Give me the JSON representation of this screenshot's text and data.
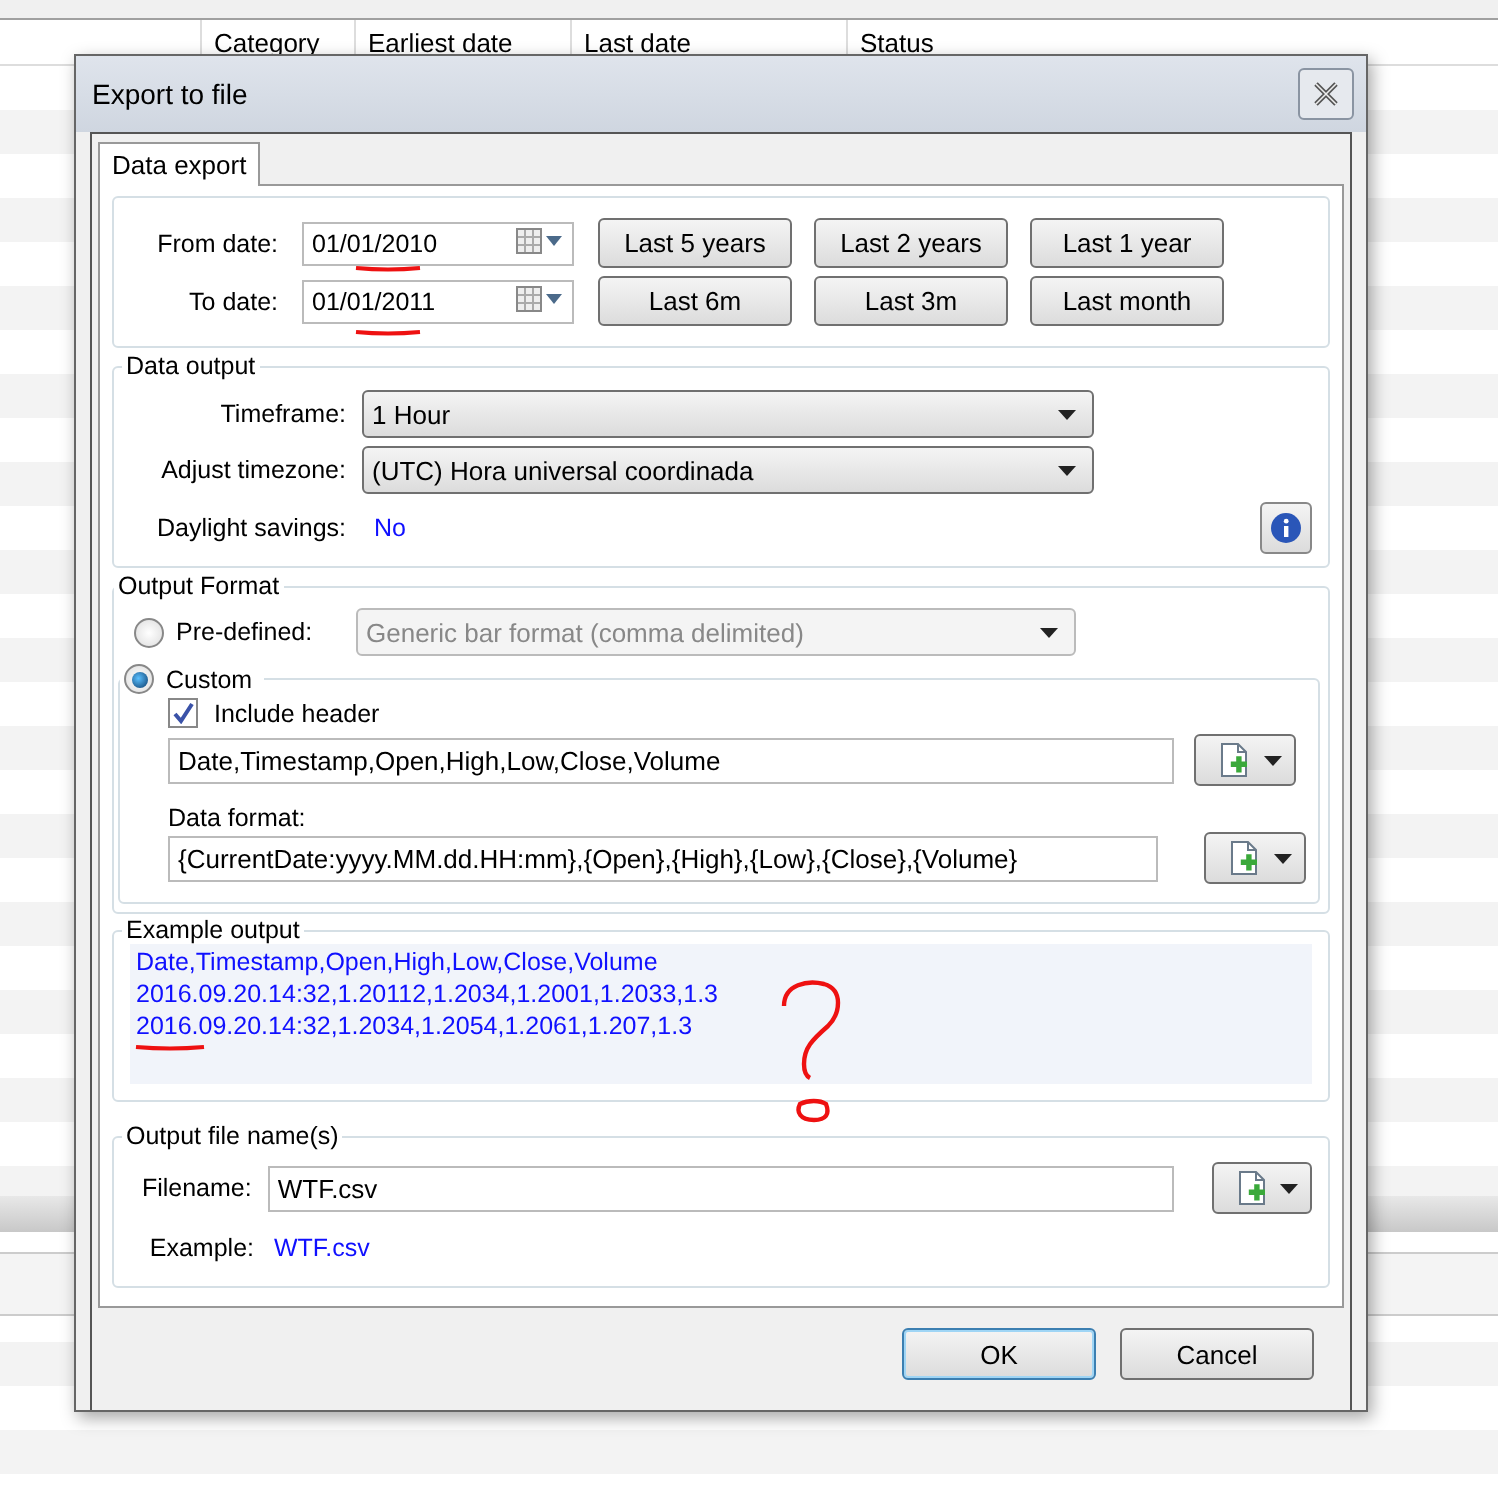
{
  "background_table": {
    "columns": [
      "Category",
      "Earliest date",
      "Last date",
      "Status"
    ]
  },
  "dialog": {
    "title": "Export to file",
    "tabs": [
      {
        "label": "Data export",
        "selected": true
      }
    ],
    "date_range": {
      "from_label": "From date:",
      "from_value": "01/01/2010",
      "to_label": "To date:",
      "to_value": "01/01/2011",
      "buttons": [
        "Last 5 years",
        "Last 2 years",
        "Last 1 year",
        "Last 6m",
        "Last 3m",
        "Last month"
      ]
    },
    "data_output": {
      "title": "Data output",
      "timeframe_label": "Timeframe:",
      "timeframe": "1 Hour",
      "timezone_label": "Adjust timezone:",
      "timezone": "(UTC) Hora universal coordinada",
      "daylight_label": "Daylight savings:",
      "daylight_value": "No"
    },
    "output_format": {
      "title": "Output Format",
      "options": [
        {
          "label": "Pre-defined:",
          "selected": false
        },
        {
          "label": "Custom",
          "selected": true
        }
      ],
      "predefined_value": "Generic bar format (comma delimited)",
      "predefined_disabled": true,
      "include_header": {
        "label": "Include header",
        "checked": true
      },
      "header_value": "Date,Timestamp,Open,High,Low,Close,Volume",
      "data_format_label": "Data format:",
      "data_format_value": "{CurrentDate:yyyy.MM.dd.HH:mm},{Open},{High},{Low},{Close},{Volume}"
    },
    "example_output": {
      "title": "Example output",
      "lines": [
        "Date,Timestamp,Open,High,Low,Close,Volume",
        "2016.09.20.14:32,1.20112,1.2034,1.2001,1.2033,1.3",
        "2016.09.20.14:32,1.2034,1.2054,1.2061,1.207,1.3"
      ]
    },
    "output_file": {
      "title": "Output file name(s)",
      "filename_label": "Filename:",
      "filename": "WTF.csv",
      "example_label": "Example:",
      "example_value": "WTF.csv"
    },
    "buttons": [
      {
        "label": "OK",
        "default": true
      },
      {
        "label": "Cancel",
        "default": false
      }
    ]
  }
}
